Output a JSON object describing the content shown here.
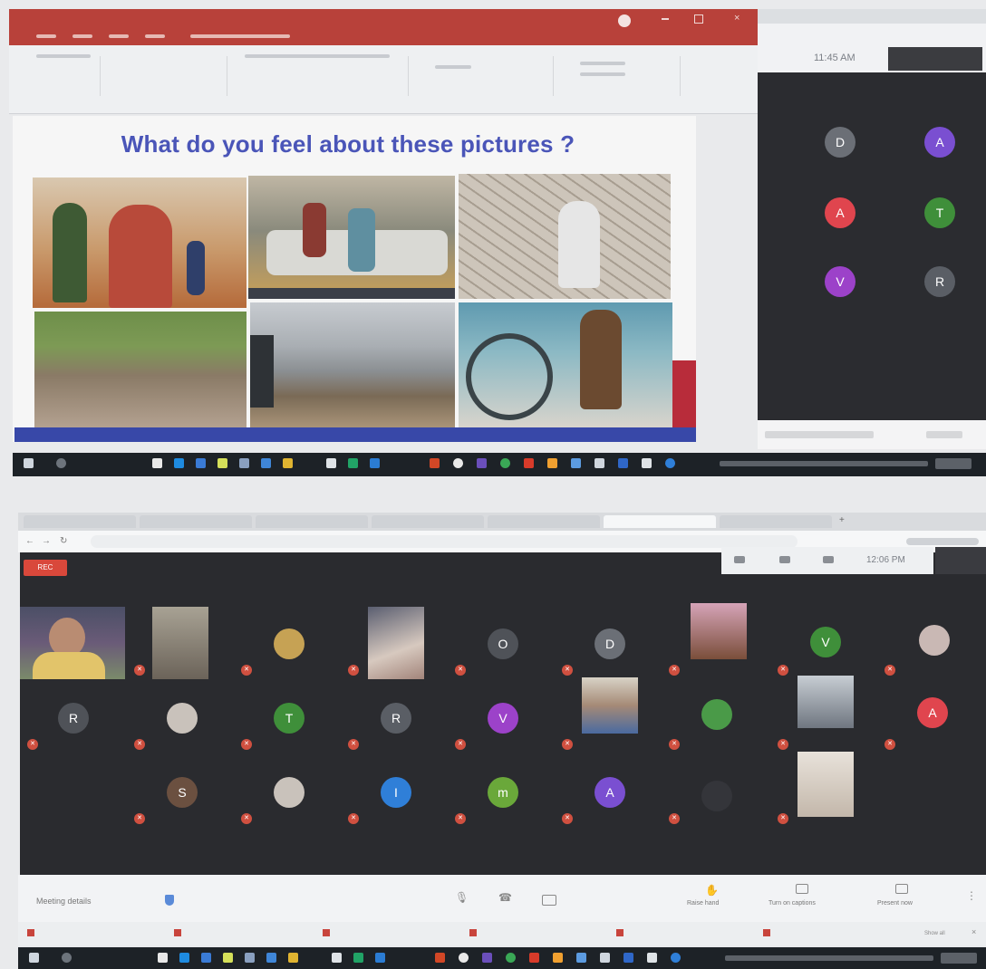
{
  "powerpoint": {
    "title": "",
    "slide": {
      "title": "What do you feel about these pictures ?"
    }
  },
  "meet_top": {
    "clock": "11:45 AM",
    "avatars": [
      {
        "letter": "D",
        "color": "#6b6f76"
      },
      {
        "letter": "A",
        "color": "#7a4fd1"
      },
      {
        "letter": "A",
        "color": "#e0454e"
      },
      {
        "letter": "T",
        "color": "#3f8f3a"
      },
      {
        "letter": "V",
        "color": "#9c42c9"
      },
      {
        "letter": "R",
        "color": "#5a5e65"
      }
    ]
  },
  "meet_bottom": {
    "recording_label": "REC",
    "clock": "12:06 PM",
    "meeting_details": "Meeting details",
    "controls": [
      "Raise hand",
      "Turn on captions",
      "Present now"
    ],
    "show_all": "Show all"
  },
  "colors": {
    "titlebar": "#b8413a",
    "slide_title": "#4a55b8",
    "slide_bar": "#3848a8",
    "meet_bg": "#2b2c30"
  }
}
